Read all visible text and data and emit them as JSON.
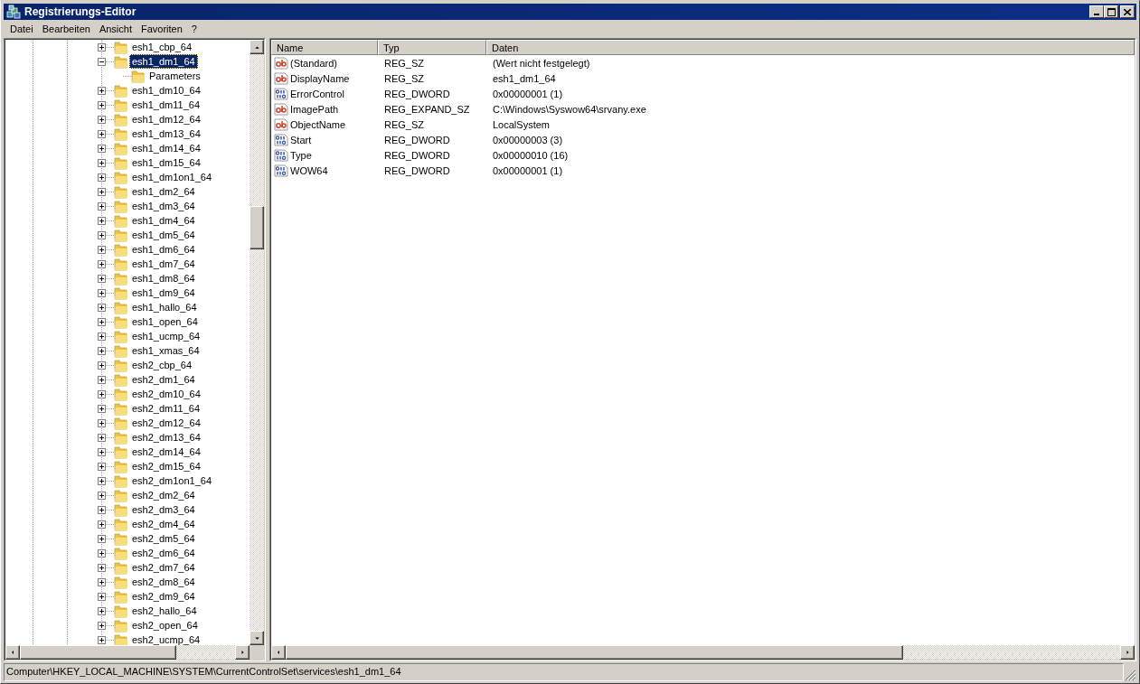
{
  "window": {
    "title": "Registrierungs-Editor"
  },
  "menu": [
    "Datei",
    "Bearbeiten",
    "Ansicht",
    "Favoriten",
    "?"
  ],
  "tree": {
    "items": [
      {
        "label": "esh1_cbp_64",
        "expanded": false,
        "selected": false
      },
      {
        "label": "esh1_dm1_64",
        "expanded": true,
        "selected": true,
        "children": [
          {
            "label": "Parameters",
            "selected": false
          }
        ]
      },
      {
        "label": "esh1_dm10_64",
        "expanded": false,
        "selected": false
      },
      {
        "label": "esh1_dm11_64",
        "expanded": false,
        "selected": false
      },
      {
        "label": "esh1_dm12_64",
        "expanded": false,
        "selected": false
      },
      {
        "label": "esh1_dm13_64",
        "expanded": false,
        "selected": false
      },
      {
        "label": "esh1_dm14_64",
        "expanded": false,
        "selected": false
      },
      {
        "label": "esh1_dm15_64",
        "expanded": false,
        "selected": false
      },
      {
        "label": "esh1_dm1on1_64",
        "expanded": false,
        "selected": false
      },
      {
        "label": "esh1_dm2_64",
        "expanded": false,
        "selected": false
      },
      {
        "label": "esh1_dm3_64",
        "expanded": false,
        "selected": false
      },
      {
        "label": "esh1_dm4_64",
        "expanded": false,
        "selected": false
      },
      {
        "label": "esh1_dm5_64",
        "expanded": false,
        "selected": false
      },
      {
        "label": "esh1_dm6_64",
        "expanded": false,
        "selected": false
      },
      {
        "label": "esh1_dm7_64",
        "expanded": false,
        "selected": false
      },
      {
        "label": "esh1_dm8_64",
        "expanded": false,
        "selected": false
      },
      {
        "label": "esh1_dm9_64",
        "expanded": false,
        "selected": false
      },
      {
        "label": "esh1_hallo_64",
        "expanded": false,
        "selected": false
      },
      {
        "label": "esh1_open_64",
        "expanded": false,
        "selected": false
      },
      {
        "label": "esh1_ucmp_64",
        "expanded": false,
        "selected": false
      },
      {
        "label": "esh1_xmas_64",
        "expanded": false,
        "selected": false
      },
      {
        "label": "esh2_cbp_64",
        "expanded": false,
        "selected": false
      },
      {
        "label": "esh2_dm1_64",
        "expanded": false,
        "selected": false
      },
      {
        "label": "esh2_dm10_64",
        "expanded": false,
        "selected": false
      },
      {
        "label": "esh2_dm11_64",
        "expanded": false,
        "selected": false
      },
      {
        "label": "esh2_dm12_64",
        "expanded": false,
        "selected": false
      },
      {
        "label": "esh2_dm13_64",
        "expanded": false,
        "selected": false
      },
      {
        "label": "esh2_dm14_64",
        "expanded": false,
        "selected": false
      },
      {
        "label": "esh2_dm15_64",
        "expanded": false,
        "selected": false
      },
      {
        "label": "esh2_dm1on1_64",
        "expanded": false,
        "selected": false
      },
      {
        "label": "esh2_dm2_64",
        "expanded": false,
        "selected": false
      },
      {
        "label": "esh2_dm3_64",
        "expanded": false,
        "selected": false
      },
      {
        "label": "esh2_dm4_64",
        "expanded": false,
        "selected": false
      },
      {
        "label": "esh2_dm5_64",
        "expanded": false,
        "selected": false
      },
      {
        "label": "esh2_dm6_64",
        "expanded": false,
        "selected": false
      },
      {
        "label": "esh2_dm7_64",
        "expanded": false,
        "selected": false
      },
      {
        "label": "esh2_dm8_64",
        "expanded": false,
        "selected": false
      },
      {
        "label": "esh2_dm9_64",
        "expanded": false,
        "selected": false
      },
      {
        "label": "esh2_hallo_64",
        "expanded": false,
        "selected": false
      },
      {
        "label": "esh2_open_64",
        "expanded": false,
        "selected": false
      },
      {
        "label": "esh2_ucmp_64",
        "expanded": false,
        "selected": false
      }
    ]
  },
  "values": {
    "columns": [
      "Name",
      "Typ",
      "Daten"
    ],
    "rows": [
      {
        "kind": "string",
        "name": "(Standard)",
        "type": "REG_SZ",
        "data": "(Wert nicht festgelegt)"
      },
      {
        "kind": "string",
        "name": "DisplayName",
        "type": "REG_SZ",
        "data": "esh1_dm1_64"
      },
      {
        "kind": "binary",
        "name": "ErrorControl",
        "type": "REG_DWORD",
        "data": "0x00000001 (1)"
      },
      {
        "kind": "string",
        "name": "ImagePath",
        "type": "REG_EXPAND_SZ",
        "data": "C:\\Windows\\Syswow64\\srvany.exe"
      },
      {
        "kind": "string",
        "name": "ObjectName",
        "type": "REG_SZ",
        "data": "LocalSystem"
      },
      {
        "kind": "binary",
        "name": "Start",
        "type": "REG_DWORD",
        "data": "0x00000003 (3)"
      },
      {
        "kind": "binary",
        "name": "Type",
        "type": "REG_DWORD",
        "data": "0x00000010 (16)"
      },
      {
        "kind": "binary",
        "name": "WOW64",
        "type": "REG_DWORD",
        "data": "0x00000001 (1)"
      }
    ]
  },
  "status_bar": "Computer\\HKEY_LOCAL_MACHINE\\SYSTEM\\CurrentControlSet\\services\\esh1_dm1_64"
}
